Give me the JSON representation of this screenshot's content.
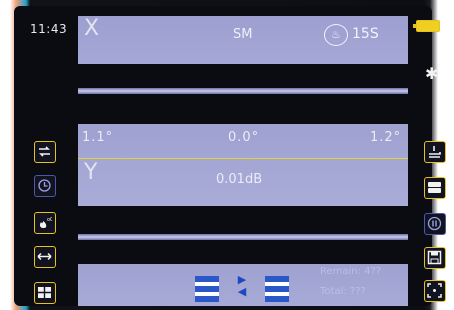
{
  "status": {
    "time": "11:43",
    "battery": "battery-full-icon",
    "bluetooth_icon": "bluetooth-icon"
  },
  "top_panel": {
    "axis": "X",
    "fiber_mode": "SM",
    "heater_icon": "heater-icon",
    "heater_icon_glyph": "♨",
    "heat_time": "15S"
  },
  "mid_panel": {
    "angle_left": "1.1°",
    "angle_center": "0.0°",
    "angle_right": "1.2°",
    "axis": "Y",
    "loss": "0.01dB"
  },
  "bottom_panel": {
    "align_arrows_top": "▶",
    "align_arrows_bottom": "◀",
    "remain": "Remain: 4??",
    "total": "Total: ???"
  },
  "left_buttons": [
    "loop-icon",
    "clock-icon",
    "flame-settings-icon",
    "width-arrows-icon",
    "grid-icon"
  ],
  "right_buttons": [
    "upload-tray-icon",
    "stack-icon",
    "pause-icon",
    "save-icon",
    "focus-icon"
  ],
  "colors": {
    "accent_border": "#e7c21a",
    "panel": "#9fa1cf",
    "background": "#0b0c12",
    "alignment_block": "#2b58c9"
  }
}
